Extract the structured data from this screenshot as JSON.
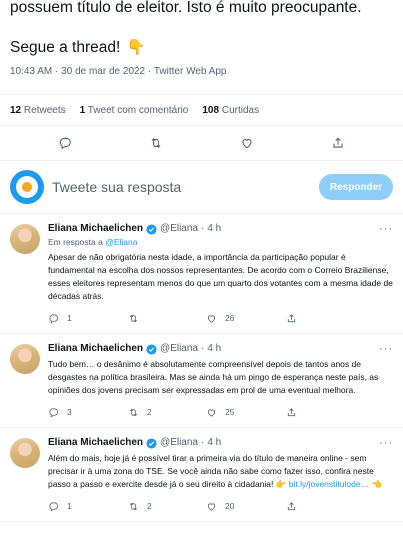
{
  "main_tweet": {
    "text_line1": "possuem título de eleitor. Isto é muito preocupante.",
    "text_line2": "Segue a thread!",
    "wave_emoji": "👇",
    "time": "10:43 AM",
    "date": "30 de mar de 2022",
    "source": "Twitter Web App",
    "dot": "·"
  },
  "stats": {
    "retweets_count": "12",
    "retweets_label": "Retweets",
    "quotes_count": "1",
    "quotes_label": "Tweet com comentário",
    "likes_count": "108",
    "likes_label": "Curtidas"
  },
  "compose": {
    "placeholder": "Tweete sua resposta",
    "button_label": "Responder"
  },
  "replies": [
    {
      "author": "Eliana Michaelichen",
      "handle": "@Eliana",
      "dot": "·",
      "time": "4 h",
      "reply_to_prefix": "Em resposta a",
      "reply_to_handle": "@Eliana",
      "text": "Apesar de não obrigatória nesta idade, a importância da participação popular é fundamental na escolha dos nossos representantes. De acordo com o Correio Braziliense, esses eleitores representam menos do que um quarto dos votantes com a mesma idade de décadas atrás.",
      "replies": "1",
      "retweets": "",
      "likes": "26"
    },
    {
      "author": "Eliana Michaelichen",
      "handle": "@Eliana",
      "dot": "·",
      "time": "4 h",
      "text": "Tudo bem… o desânimo é absolutamente compreensível depois de tantos anos de desgastes na política brasileira. Mas se ainda há um pingo de esperança neste país, as opiniões dos jovens precisam ser expressadas em prol de uma eventual melhora.",
      "replies": "3",
      "retweets": "2",
      "likes": "25"
    },
    {
      "author": "Eliana Michaelichen",
      "handle": "@Eliana",
      "dot": "·",
      "time": "4 h",
      "text": "Além do mais, hoje já é possível tirar a primeira via do título de maneira online - sem precisar ir à uma zona do TSE. Se você ainda não sabe como fazer isso, confira neste passo a passo e exercite desde já o seu direito à cidadania!",
      "emoji_before_link": "👉",
      "link": "bit.ly/jovenstitulode…",
      "emoji_after_link": "👈",
      "replies": "1",
      "retweets": "2",
      "likes": "20"
    }
  ],
  "colors": {
    "accent": "#1d9bf0",
    "button_disabled": "#8ecdf8",
    "muted_text": "#536471",
    "divider": "#eff3f4"
  },
  "icons": [
    "reply-icon",
    "retweet-icon",
    "like-icon",
    "share-icon",
    "verified-badge-icon",
    "more-icon"
  ]
}
